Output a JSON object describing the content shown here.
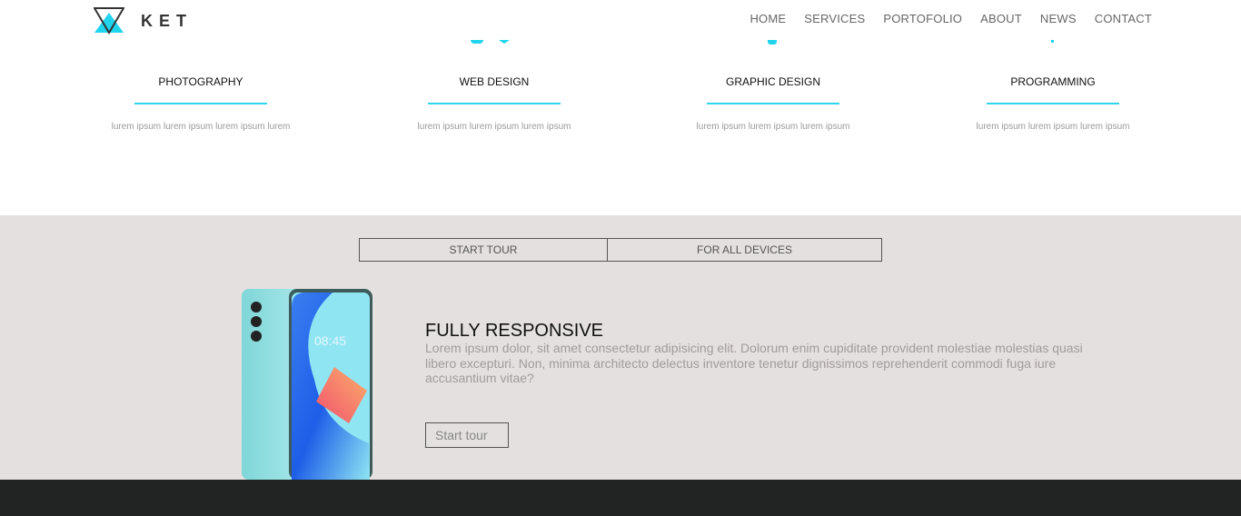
{
  "brand": {
    "name": "KET",
    "accent": "#20d4ee"
  },
  "nav": [
    "HOME",
    "SERVICES",
    "PORTOFOLIO",
    "ABOUT",
    "NEWS",
    "CONTACT"
  ],
  "services": [
    {
      "title": "PHOTOGRAPHY",
      "text": "lurem ipsum lurem ipsum lurem ipsum lurem"
    },
    {
      "title": "WEB DESIGN",
      "text": "lurem ipsum lurem ipsum lurem ipsum"
    },
    {
      "title": "GRAPHIC DESIGN",
      "text": "lurem ipsum lurem ipsum lurem ipsum"
    },
    {
      "title": "PROGRAMMING",
      "text": "lurem ipsum lurem ipsum lurem ipsum"
    }
  ],
  "tabs": [
    "START TOUR",
    "FOR ALL DEVICES"
  ],
  "feature": {
    "title": "FULLY RESPONSIVE",
    "text": "Lorem ipsum dolor, sit amet consectetur adipisicing elit. Dolorum enim cupiditate provident molestiae molestias quasi libero excepturi. Non, minima architecto delectus inventore tenetur dignissimos reprehenderit commodi fuga iure accusantium vitae?",
    "button": "Start tour",
    "phone_time": "08:45"
  }
}
